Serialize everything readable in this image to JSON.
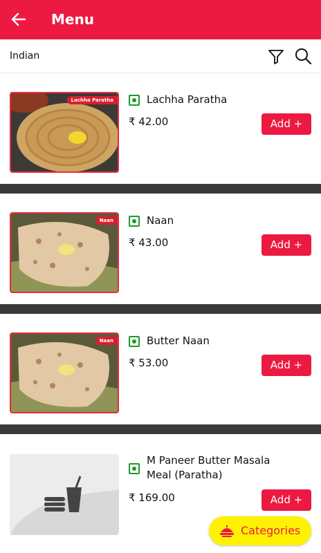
{
  "header": {
    "title": "Menu",
    "back_icon": "arrow-left-icon"
  },
  "subheader": {
    "category": "Indian",
    "filter_icon": "filter-icon",
    "search_icon": "search-icon"
  },
  "colors": {
    "brand": "#ec1a41",
    "veg": "#1c9a2a",
    "fab": "#fef200",
    "divider": "#3a3a3a"
  },
  "items": [
    {
      "image_tag": "Lachha Paratha",
      "name": "Lachha Paratha",
      "price": "₹ 42.00",
      "add_label": "Add +"
    },
    {
      "image_tag": "Naan",
      "name": "Naan",
      "price": "₹ 43.00",
      "add_label": "Add +"
    },
    {
      "image_tag": "Naan",
      "name": "Butter Naan",
      "price": "₹ 53.00",
      "add_label": "Add +"
    },
    {
      "image_tag": "",
      "name": "M Paneer Butter Masala Meal (Paratha)",
      "price": "₹ 169.00",
      "add_label": "Add +"
    }
  ],
  "fab": {
    "label": "Categories",
    "icon": "food-tray-icon"
  }
}
